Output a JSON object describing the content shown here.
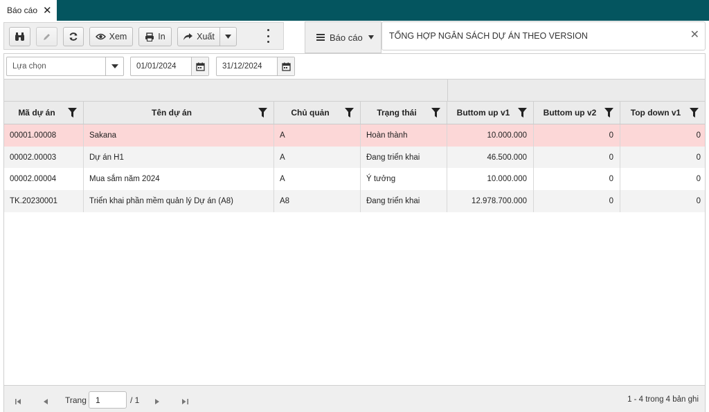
{
  "tab": {
    "label": "Báo cáo"
  },
  "toolbar": {
    "view_label": "Xem",
    "print_label": "In",
    "export_label": "Xuất"
  },
  "report": {
    "menu_label": "Báo cáo",
    "title": "TỔNG HỢP NGÂN SÁCH DỰ ÁN THEO VERSION"
  },
  "filters": {
    "select_placeholder": "Lựa chọn",
    "date_from": "01/01/2024",
    "date_to": "31/12/2024"
  },
  "grid": {
    "columns": [
      "Mã dự án",
      "Tên dự án",
      "Chủ quản",
      "Trạng thái",
      "Buttom up v1",
      "Buttom up v2",
      "Top down v1"
    ],
    "rows": [
      [
        "00001.00008",
        "Sakana",
        "A",
        "Hoàn thành",
        "10.000.000",
        "0",
        "0"
      ],
      [
        "00002.00003",
        "Dự án H1",
        "A",
        "Đang triển khai",
        "46.500.000",
        "0",
        "0"
      ],
      [
        "00002.00004",
        "Mua sắm năm 2024",
        "A",
        "Ý tưởng",
        "10.000.000",
        "0",
        "0"
      ],
      [
        "TK.20230001",
        "Triển khai phần mềm quản lý Dự án (A8)",
        "A8",
        "Đang triển khai",
        "12.978.700.000",
        "0",
        "0"
      ]
    ],
    "row_colors": [
      "#fcd7d7",
      "#f3f3f3",
      "#ffffff",
      "#f3f3f3"
    ]
  },
  "pager": {
    "page_label": "Trang",
    "page_value": "1",
    "page_total": "/ 1",
    "info": "1 - 4 trong 4 bản ghi"
  }
}
